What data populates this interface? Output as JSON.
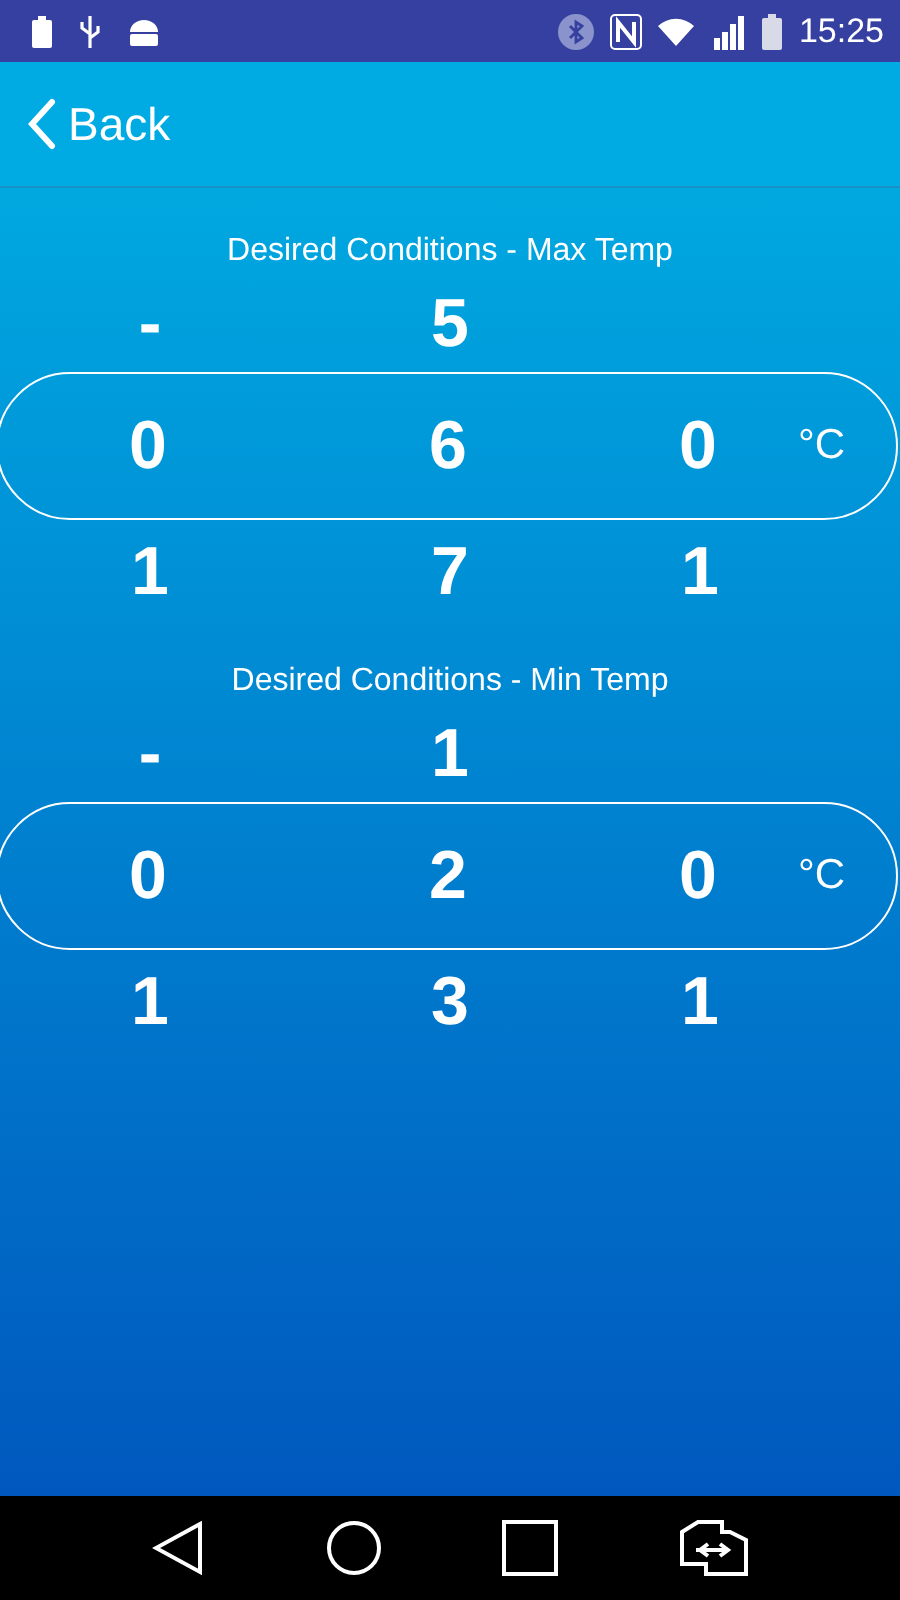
{
  "status_bar": {
    "time": "15:25"
  },
  "header": {
    "back_label": "Back"
  },
  "pickers": [
    {
      "title": "Desired Conditions - Max Temp",
      "unit": "°C",
      "columns": [
        {
          "above": "-",
          "value": "0",
          "below": "1"
        },
        {
          "above": "5",
          "value": "6",
          "below": "7"
        },
        {
          "value": "0",
          "below": "1"
        }
      ]
    },
    {
      "title": "Desired Conditions - Min Temp",
      "unit": "°C",
      "columns": [
        {
          "above": "-",
          "value": "0",
          "below": "1"
        },
        {
          "above": "1",
          "value": "2",
          "below": "3"
        },
        {
          "value": "0",
          "below": "1"
        }
      ]
    }
  ]
}
